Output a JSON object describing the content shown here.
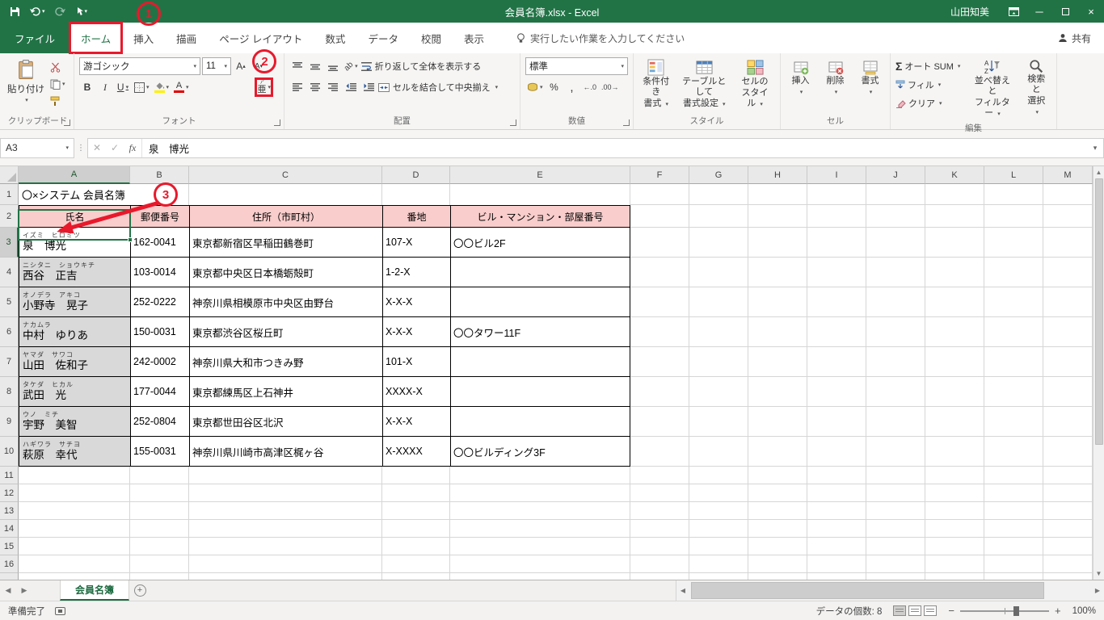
{
  "colors": {
    "brand_green": "#217346",
    "annotation_red": "#E8192C",
    "table_header_fill": "#F8CDCB",
    "selection_green": "#217346"
  },
  "titlebar": {
    "title": "会員名簿.xlsx - Excel",
    "user": "山田知美"
  },
  "tabbar": {
    "file": "ファイル",
    "tabs": [
      "ホーム",
      "挿入",
      "描画",
      "ページ レイアウト",
      "数式",
      "データ",
      "校閲",
      "表示"
    ],
    "active": "ホーム",
    "tellme": "実行したい作業を入力してください",
    "share": "共有"
  },
  "ribbon": {
    "clipboard": {
      "label": "クリップボード",
      "paste": "貼り付け"
    },
    "font": {
      "label": "フォント",
      "name": "游ゴシック",
      "size": "11",
      "phonetic_icon": {
        "ruby": "ア",
        "base": "亜"
      }
    },
    "alignment": {
      "label": "配置",
      "wrap": "折り返して全体を表示する",
      "merge": "セルを結合して中央揃え"
    },
    "number": {
      "label": "数値",
      "format": "標準"
    },
    "styles": {
      "label": "スタイル",
      "conditional": [
        "条件付き",
        "書式"
      ],
      "format_table": [
        "テーブルとして",
        "書式設定"
      ],
      "cell_styles": [
        "セルの",
        "スタイル"
      ]
    },
    "cells": {
      "label": "セル",
      "insert": "挿入",
      "delete": "削除",
      "format": "書式"
    },
    "editing": {
      "label": "編集",
      "autosum": "オート SUM",
      "fill": "フィル",
      "clear": "クリア",
      "sort": [
        "並べ替えと",
        "フィルター"
      ],
      "find": [
        "検索と",
        "選択"
      ]
    }
  },
  "formula_bar": {
    "name_box": "A3",
    "formula": "泉　博光"
  },
  "sheet": {
    "columns": [
      "A",
      "B",
      "C",
      "D",
      "E",
      "F",
      "G",
      "H",
      "I",
      "J",
      "K",
      "L",
      "M"
    ],
    "rows": [
      1,
      2,
      3,
      4,
      5,
      6,
      7,
      8,
      9,
      10,
      11,
      12,
      13,
      14,
      15,
      16
    ],
    "active_column": "A",
    "active_row": 3,
    "active_cell": "A3",
    "title_cell": "〇×システム 会員名簿",
    "table_headers": [
      "氏名",
      "郵便番号",
      "住所（市町村）",
      "番地",
      "ビル・マンション・部屋番号"
    ],
    "members": [
      {
        "furigana": "イズミ　ヒロミツ",
        "name": "泉　博光",
        "zip": "162-0041",
        "address": "東京都新宿区早稲田鶴巻町",
        "banchi": "107-X",
        "building": "〇〇ビル2F"
      },
      {
        "furigana": "ニシタニ　ショウキチ",
        "name": "西谷　正吉",
        "zip": "103-0014",
        "address": "東京都中央区日本橋蛎殻町",
        "banchi": "1-2-X",
        "building": ""
      },
      {
        "furigana": "オノデラ　アキコ",
        "name": "小野寺　晃子",
        "zip": "252-0222",
        "address": "神奈川県相模原市中央区由野台",
        "banchi": "X-X-X",
        "building": ""
      },
      {
        "furigana": "ナカムラ",
        "name": "中村　ゆりあ",
        "zip": "150-0031",
        "address": "東京都渋谷区桜丘町",
        "banchi": "X-X-X",
        "building": "〇〇タワー11F"
      },
      {
        "furigana": "ヤマダ　サワコ",
        "name": "山田　佐和子",
        "zip": "242-0002",
        "address": "神奈川県大和市つきみ野",
        "banchi": "101-X",
        "building": ""
      },
      {
        "furigana": "タケダ　ヒカル",
        "name": "武田　光",
        "zip": "177-0044",
        "address": "東京都練馬区上石神井",
        "banchi": "XXXX-X",
        "building": ""
      },
      {
        "furigana": "ウノ　ミチ",
        "name": "宇野　美智",
        "zip": "252-0804",
        "address": "東京都世田谷区北沢",
        "banchi": "X-X-X",
        "building": ""
      },
      {
        "furigana": "ハギワラ　サチヨ",
        "name": "萩原　幸代",
        "zip": "155-0031",
        "address": "神奈川県川崎市高津区梶ヶ谷",
        "banchi": "X-XXXX",
        "building": "〇〇ビルディング3F"
      }
    ],
    "sheet_tab": "会員名簿"
  },
  "statusbar": {
    "ready": "準備完了",
    "count": "データの個数: 8",
    "zoom": "100%"
  },
  "annotations": {
    "n1": "1",
    "n2": "2",
    "n3": "3"
  }
}
